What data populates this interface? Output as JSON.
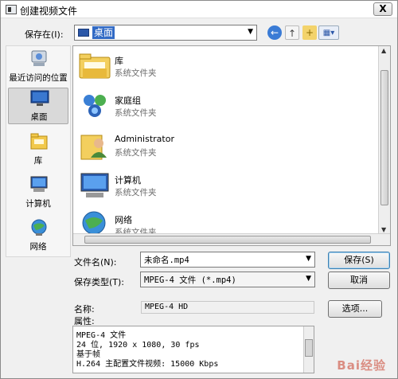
{
  "window": {
    "title": "创建视频文件",
    "close_glyph": "X"
  },
  "toolbar": {
    "save_in_label": "保存在(I):",
    "location": "桌面",
    "back_icon": "back-arrow-icon",
    "up_icon": "up-folder-icon",
    "new_folder_icon": "new-folder-icon",
    "view_icon": "view-menu-icon"
  },
  "places": [
    {
      "label": "最近访问的位置",
      "icon": "recent-places-icon"
    },
    {
      "label": "桌面",
      "icon": "desktop-icon",
      "selected": true
    },
    {
      "label": "库",
      "icon": "libraries-icon"
    },
    {
      "label": "计算机",
      "icon": "computer-icon"
    },
    {
      "label": "网络",
      "icon": "network-icon"
    }
  ],
  "files": [
    {
      "name": "库",
      "type": "系统文件夹",
      "icon": "libraries-folder-icon"
    },
    {
      "name": "家庭组",
      "type": "系统文件夹",
      "icon": "homegroup-icon"
    },
    {
      "name": "Administrator",
      "type": "系统文件夹",
      "icon": "user-folder-icon"
    },
    {
      "name": "计算机",
      "type": "系统文件夹",
      "icon": "computer-icon"
    },
    {
      "name": "网络",
      "type": "系统文件夹",
      "icon": "network-icon"
    }
  ],
  "form": {
    "filename_label": "文件名(N):",
    "filename_value": "未命名.mp4",
    "filetype_label": "保存类型(T):",
    "filetype_value": "MPEG-4 文件 (*.mp4)",
    "save_button": "保存(S)",
    "cancel_button": "取消"
  },
  "info": {
    "name_label": "名称:",
    "name_value": "MPEG-4 HD",
    "options_button": "选项...",
    "props_label": "属性:",
    "props_lines": [
      "MPEG-4 文件",
      "24 位, 1920 x 1080, 30 fps",
      "基于帧",
      "H.264 主配置文件视频: 15000 Kbps"
    ]
  },
  "watermark": "Bai经验"
}
